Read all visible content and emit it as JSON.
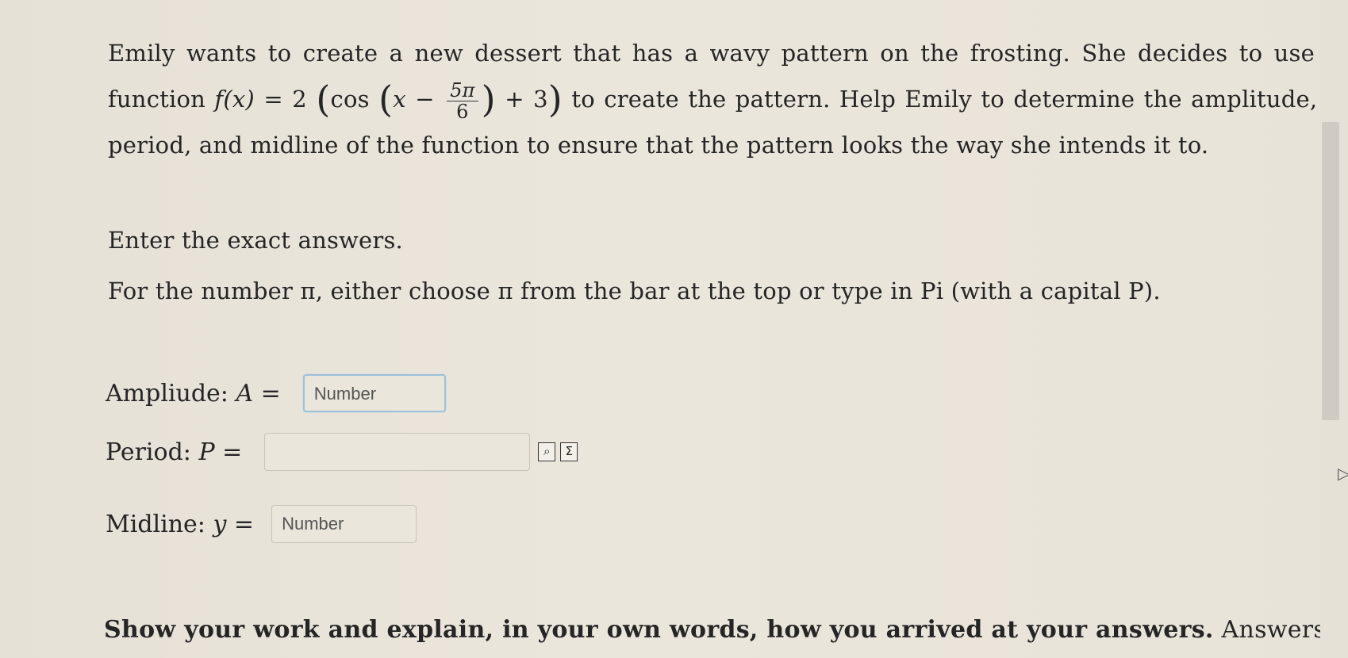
{
  "question": {
    "line1": "Emily wants to create a new dessert that has a wavy pattern on the frosting. She decides to use the",
    "line2_prefix": "function ",
    "func_name": "f",
    "func_arg": "(x)",
    "func_eq": " = 2",
    "cos_text": "cos",
    "cos_var": "x − ",
    "frac_num": "5π",
    "frac_den": "6",
    "plus_three": " + 3",
    "line2_suffix": " to create the pattern. Help Emily to determine the amplitude,",
    "line3": "period, and midline of the function to ensure that the pattern looks the way she intends it to."
  },
  "instructions": {
    "exact": "Enter the exact answers.",
    "pi_note": "For the number π, either choose π from the bar at the top or type in Pi (with a capital P)."
  },
  "fields": {
    "amplitude_label": "Ampliude: ",
    "amplitude_var": "A",
    "amplitude_eq": " =",
    "amplitude_placeholder": "Number",
    "period_label": "Period: ",
    "period_var": "P",
    "period_eq": " =",
    "period_placeholder": "",
    "midline_label": "Midline: ",
    "midline_var": "y",
    "midline_eq": " =",
    "midline_placeholder": "Number"
  },
  "toolbar_icons": {
    "preview_icon": "preview-icon",
    "equation_editor_icon": "sigma-icon",
    "preview_glyph": "⌕",
    "sigma_glyph": "Σ"
  },
  "footer": {
    "bold_text": "Show your work and explain, in your own words, how you arrived at your answers.",
    "normal_text": " Answers with"
  }
}
